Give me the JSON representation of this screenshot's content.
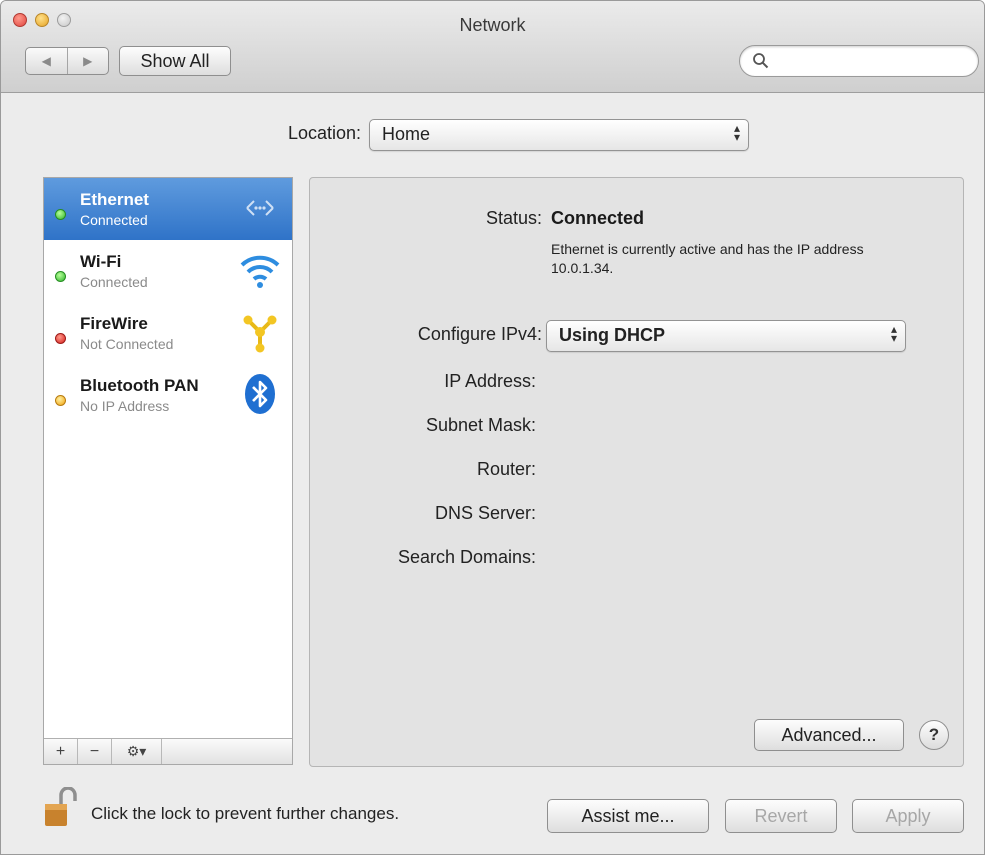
{
  "window": {
    "title": "Network"
  },
  "toolbar": {
    "back_icon": "back-arrow-icon",
    "forward_icon": "forward-arrow-icon",
    "show_all_label": "Show All",
    "search_placeholder": ""
  },
  "location": {
    "label": "Location:",
    "value": "Home"
  },
  "services": [
    {
      "name": "Ethernet",
      "status": "Connected",
      "status_color": "green",
      "icon": "ethernet-icon",
      "selected": true
    },
    {
      "name": "Wi-Fi",
      "status": "Connected",
      "status_color": "green",
      "icon": "wifi-icon",
      "selected": false
    },
    {
      "name": "FireWire",
      "status": "Not Connected",
      "status_color": "red",
      "icon": "firewire-icon",
      "selected": false
    },
    {
      "name": "Bluetooth PAN",
      "status": "No IP Address",
      "status_color": "yellow",
      "icon": "bluetooth-icon",
      "selected": false
    }
  ],
  "sidebar_tools": {
    "add": "+",
    "remove": "−",
    "gear": "⚙▾"
  },
  "detail": {
    "status_label": "Status:",
    "status_value": "Connected",
    "status_description": "Ethernet is currently active and has the IP address 10.0.1.34.",
    "configure_label": "Configure IPv4:",
    "configure_value": "Using DHCP",
    "ip_label": "IP Address:",
    "subnet_label": "Subnet Mask:",
    "router_label": "Router:",
    "dns_label": "DNS Server:",
    "search_domains_label": "Search Domains:",
    "advanced_label": "Advanced...",
    "help_label": "?"
  },
  "footer": {
    "lock_text": "Click the lock to prevent further changes.",
    "assist_label": "Assist me...",
    "revert_label": "Revert",
    "apply_label": "Apply"
  },
  "colors": {
    "selection": "#3a7fd0",
    "status_green": "#2fb52b",
    "status_red": "#d51f1b",
    "status_yellow": "#f0a10e"
  }
}
